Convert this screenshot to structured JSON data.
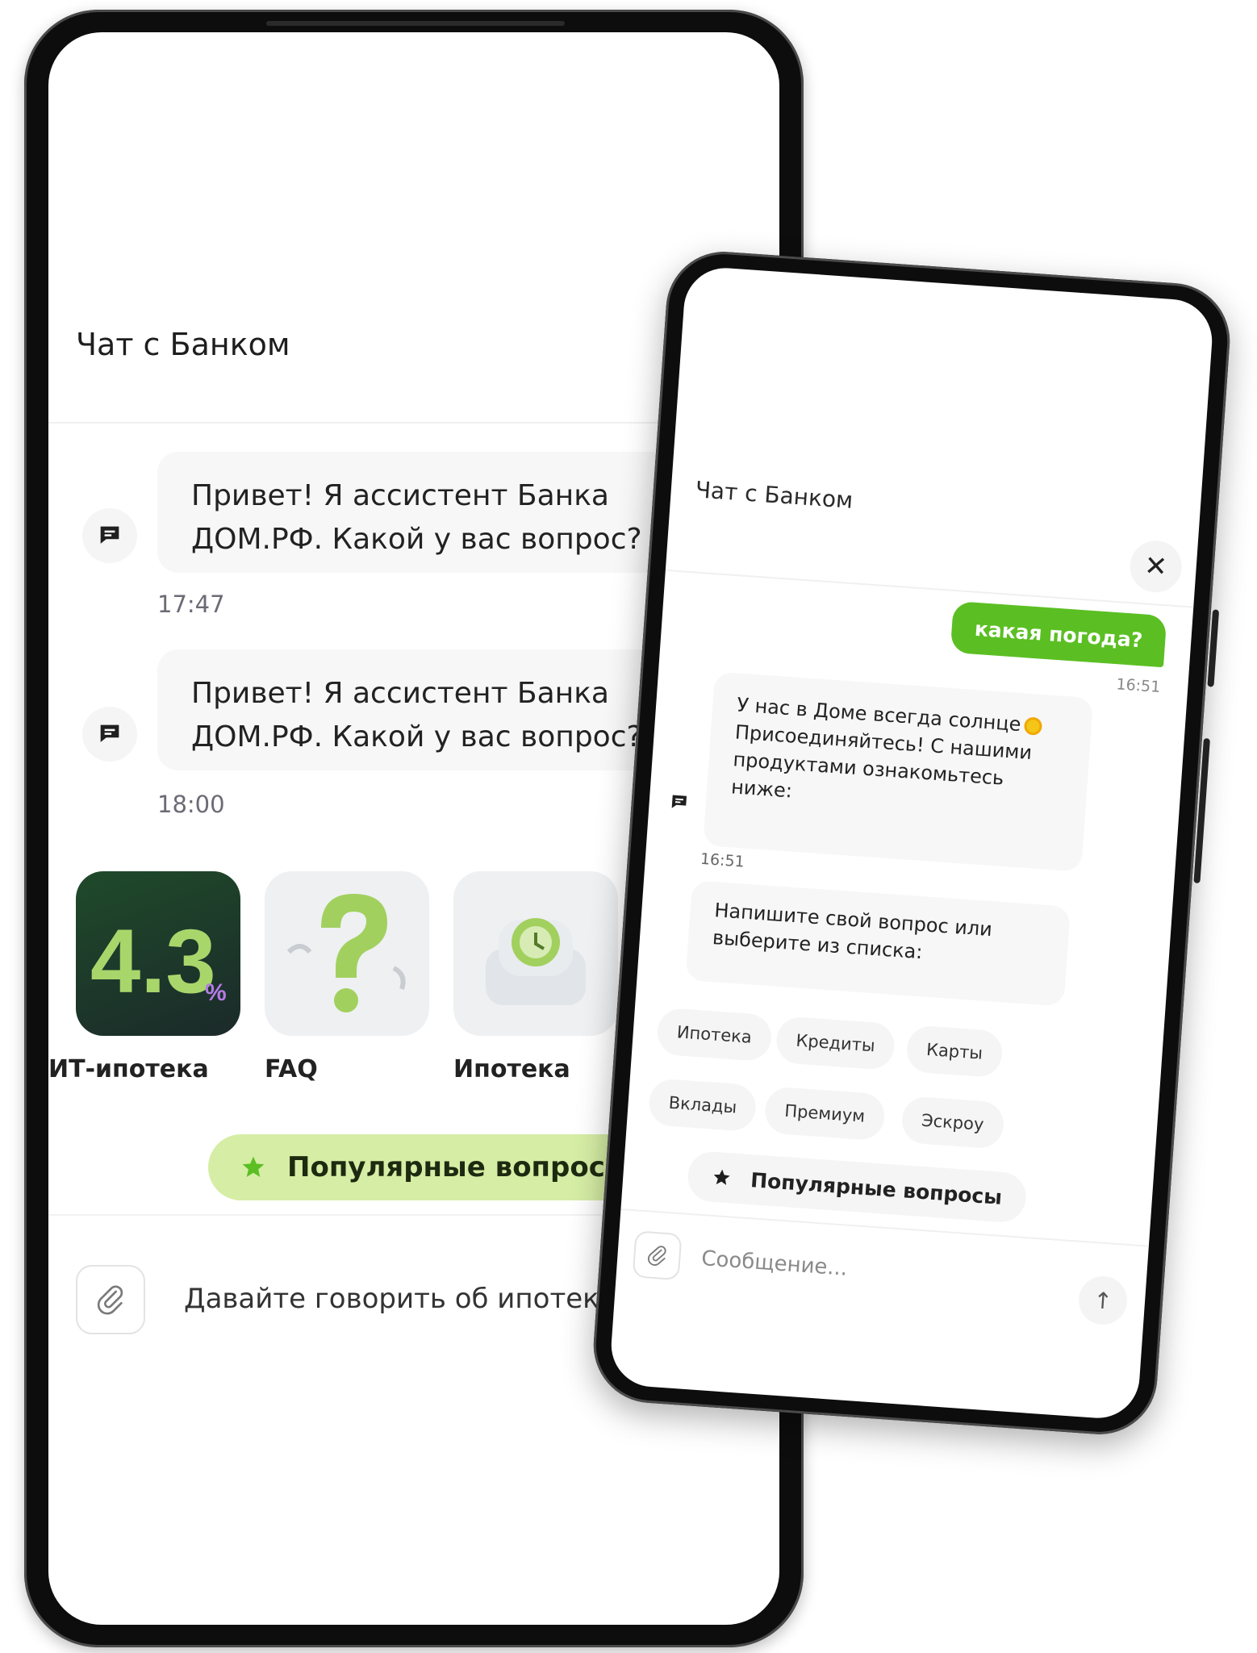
{
  "back_phone": {
    "header": {
      "title": "Чат с Банком"
    },
    "messages": [
      {
        "text_line1": "Привет! Я ассистент Банка",
        "text_line2": "ДОМ.РФ. Какой у вас вопрос?",
        "time": "17:47"
      },
      {
        "text_line1": "Привет! Я ассистент Банка",
        "text_line2": "ДОМ.РФ. Какой у вас вопрос?",
        "time": "18:00"
      }
    ],
    "cards": [
      {
        "label": "ИТ-ипотека",
        "badge": "4.3",
        "badge_suffix": "%",
        "bg": "#2b4a2e"
      },
      {
        "label": "FAQ",
        "icon": "question-mark-icon",
        "bg": "#eef0f2"
      },
      {
        "label": "Ипотека",
        "icon": "armchair-clock-icon",
        "bg": "#eef0f2"
      }
    ],
    "popular_button": {
      "label": "Популярные вопросы"
    },
    "input": {
      "placeholder": "Давайте говорить об ипотеке"
    }
  },
  "front_phone": {
    "header": {
      "title": "Чат с Банком"
    },
    "user_message": {
      "text": "какая погода?",
      "time": "16:51"
    },
    "bot_message": {
      "line1": "У нас в Доме всегда солнце",
      "line2": "Присоединяйтесь! С нашими",
      "line3": "продуктами ознакомьтесь",
      "line4": "ниже:",
      "time": "16:51"
    },
    "prompt_message": {
      "line1": "Напишите свой вопрос или",
      "line2": "выберите из списка:"
    },
    "chips": [
      "Ипотека",
      "Кредиты",
      "Карты",
      "Вклады",
      "Премиум",
      "Эскроу"
    ],
    "popular_button": {
      "label": "Популярные вопросы"
    },
    "input": {
      "placeholder": "Сообщение..."
    }
  },
  "colors": {
    "accent_green": "#5bbf23",
    "light_green": "#d6eda5",
    "bubble_gray": "#f7f7f7"
  }
}
